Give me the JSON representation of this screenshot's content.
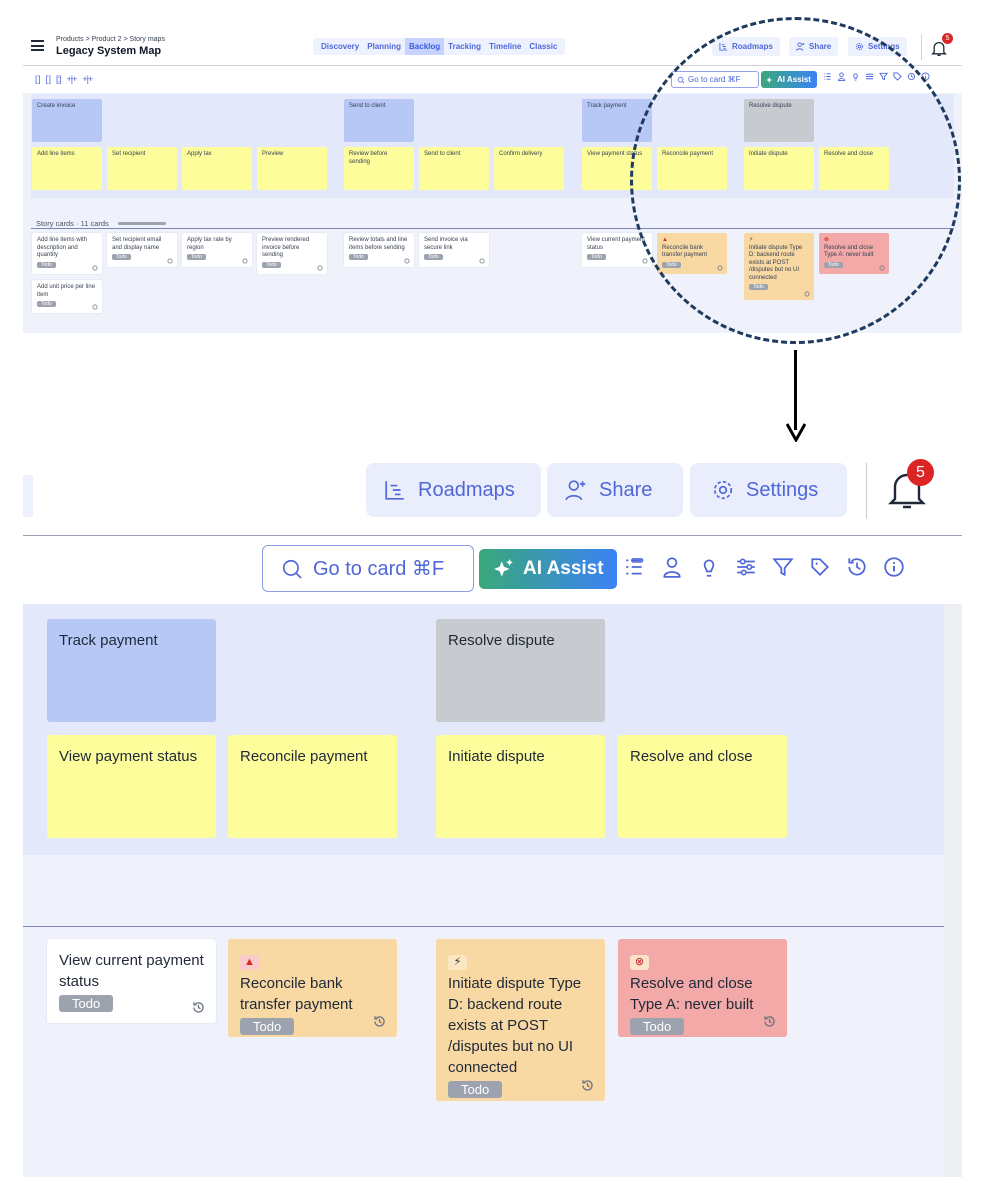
{
  "header": {
    "breadcrumb": "Products > Product 2 > Story maps",
    "title": "Legacy System Map",
    "tabs": [
      "Discovery",
      "Planning",
      "Backlog",
      "Tracking",
      "Timeline",
      "Classic"
    ],
    "active_tab": "Backlog",
    "roadmaps": "Roadmaps",
    "share": "Share",
    "settings": "Settings",
    "notifications_count": "5"
  },
  "toolbar": {
    "goto": "Go to card ⌘F",
    "ai_assist": "AI Assist",
    "view_icons": [
      "[ ]",
      "[ ]",
      "[:]",
      "+|+",
      "+|+"
    ]
  },
  "epics": {
    "create_invoice": "Create invoice",
    "send_to_client": "Send to client",
    "track_payment": "Track payment",
    "resolve_dispute": "Resolve dispute"
  },
  "steps": {
    "add_line_items": "Add line items",
    "set_recipient": "Set recipient",
    "apply_tax": "Apply tax",
    "preview": "Preview",
    "review_before_sending": "Review before sending",
    "send_to_client": "Send to client",
    "confirm_delivery": "Confirm delivery",
    "view_payment_status": "View payment status",
    "reconcile_payment": "Reconcile payment",
    "initiate_dispute": "Initiate dispute",
    "resolve_and_close": "Resolve and close"
  },
  "story_cards": {
    "label": "Story cards · 11 cards",
    "status": "Todo",
    "s1": "Add line items with description and quantity",
    "s2": "Add unit price per line item",
    "s3": "Set recipient email and display name",
    "s4": "Apply tax rate by region",
    "s5": "Preview rendered invoice before sending",
    "s6": "Review totals and line items before sending",
    "s7": "Send invoice via secure link",
    "s8": "View current payment status",
    "s9": "Reconcile bank transfer payment",
    "s10": "Initiate dispute Type D: backend route exists at POST /disputes but no UI connected",
    "s11": "Resolve and close Type A: never built"
  },
  "colors": {
    "accent": "#4f67d8",
    "epic_blue": "#b7c8f7",
    "epic_gray": "#c7cacf",
    "step_yellow": "#fdfd9c",
    "warn_orange": "#f8d8a3",
    "error_red": "#f2a9a7",
    "badge_red": "#dc2626"
  }
}
